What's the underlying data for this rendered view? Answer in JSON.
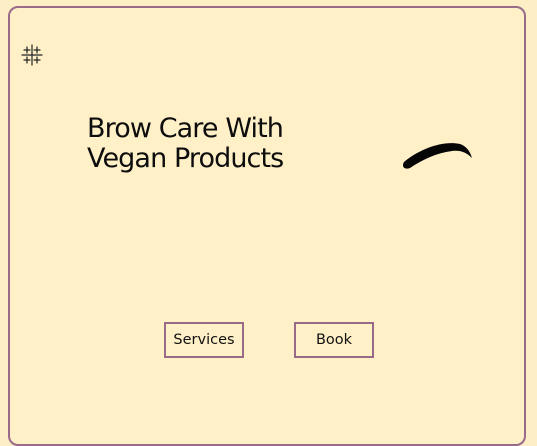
{
  "hero": {
    "headline_line1": "Brow Care With",
    "headline_line2": "Vegan Products"
  },
  "buttons": {
    "services_label": "Services",
    "book_label": "Book"
  },
  "icons": {
    "logo": "sparkle-cluster-icon",
    "illustration": "eyebrow-icon"
  },
  "colors": {
    "background": "#fff0c7",
    "border": "#9a6a8a",
    "text": "#0d0d0d"
  }
}
